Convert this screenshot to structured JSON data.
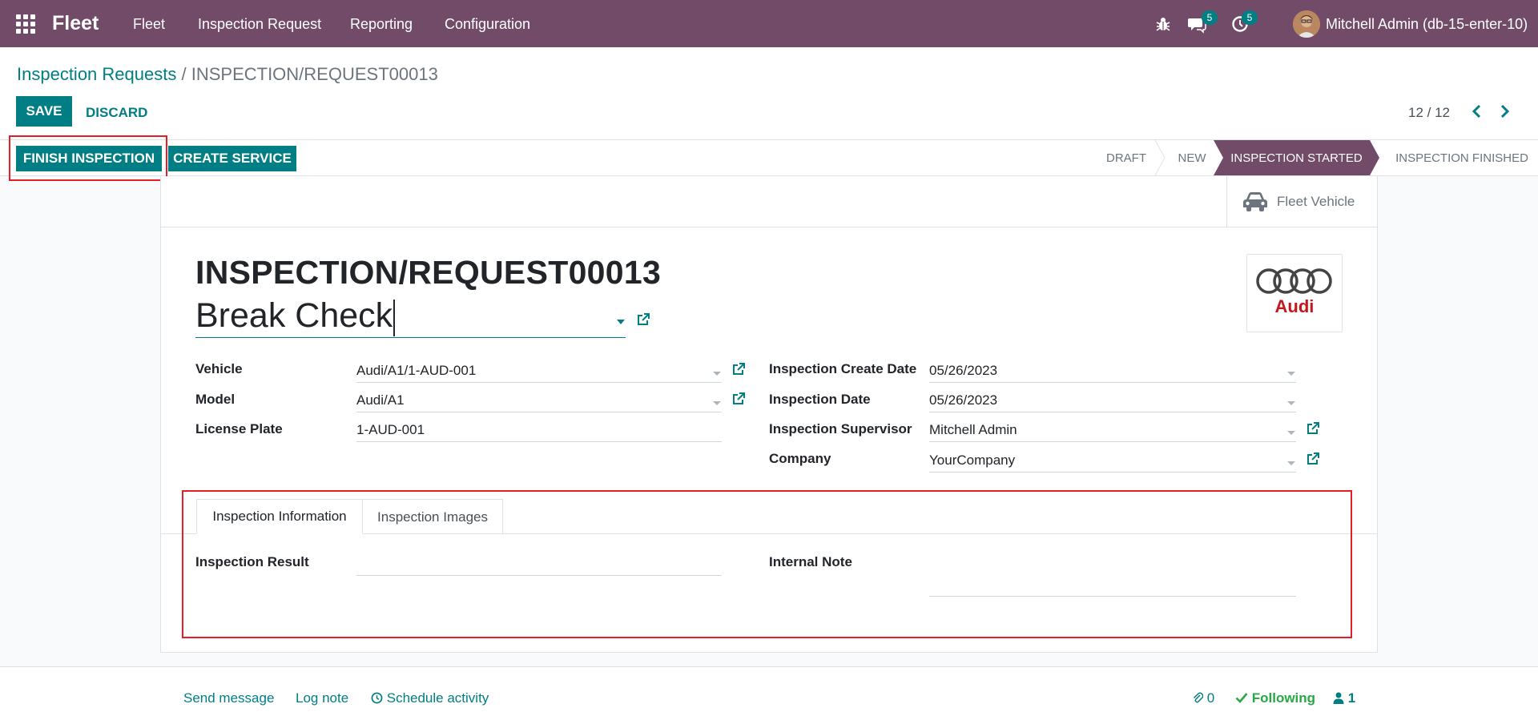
{
  "navbar": {
    "brand": "Fleet",
    "menu": [
      "Fleet",
      "Inspection Request",
      "Reporting",
      "Configuration"
    ],
    "messages_count": "5",
    "activities_count": "5",
    "user": "Mitchell Admin (db-15-enter-10)"
  },
  "breadcrumb": {
    "parent": "Inspection Requests",
    "separator": "/",
    "current": "INSPECTION/REQUEST00013"
  },
  "actions": {
    "save": "SAVE",
    "discard": "DISCARD",
    "finish_inspection": "FINISH INSPECTION",
    "create_service": "CREATE SERVICE"
  },
  "pager": {
    "value": "12 / 12"
  },
  "statusbar": {
    "stages": [
      "DRAFT",
      "NEW",
      "INSPECTION STARTED",
      "INSPECTION FINISHED"
    ],
    "active": "INSPECTION STARTED"
  },
  "smart_button": {
    "label": "Fleet Vehicle",
    "icon": "car-icon"
  },
  "record": {
    "reference": "INSPECTION/REQUEST00013",
    "name": "Break Check",
    "logo_text": "Audi"
  },
  "left_fields": [
    {
      "label": "Vehicle",
      "value": "Audi/A1/1-AUD-001"
    },
    {
      "label": "Model",
      "value": "Audi/A1"
    },
    {
      "label": "License Plate",
      "value": "1-AUD-001"
    }
  ],
  "right_fields": [
    {
      "label": "Inspection Create Date",
      "value": "05/26/2023"
    },
    {
      "label": "Inspection Date",
      "value": "05/26/2023"
    },
    {
      "label": "Inspection Supervisor",
      "value": "Mitchell Admin"
    },
    {
      "label": "Company",
      "value": "YourCompany"
    }
  ],
  "tabs": {
    "items": [
      "Inspection Information",
      "Inspection Images"
    ],
    "active": "Inspection Information"
  },
  "tab_content": {
    "result_label": "Inspection Result",
    "result_value": "",
    "note_label": "Internal Note",
    "note_value": ""
  },
  "chatter": {
    "send_message": "Send message",
    "log_note": "Log note",
    "schedule_activity": "Schedule activity",
    "attachments": "0",
    "following": "Following",
    "followers": "1"
  },
  "colors": {
    "brand": "#714b67",
    "primary": "#017e84",
    "highlight": "#e31e24"
  }
}
